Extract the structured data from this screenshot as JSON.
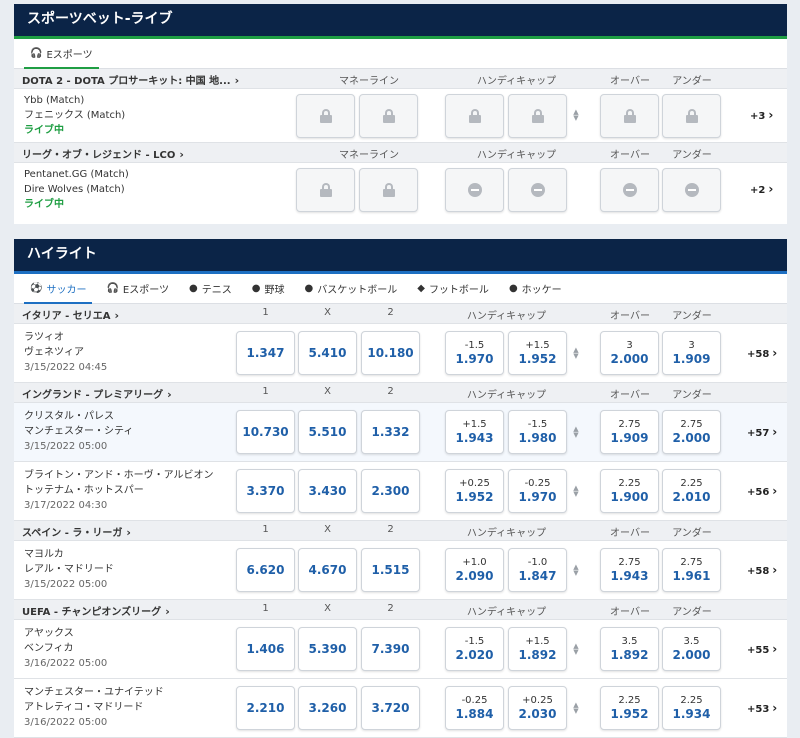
{
  "live": {
    "title": "スポーツベット-ライブ",
    "tab": "Eスポーツ",
    "columns": {
      "moneyline": "マネーライン",
      "handicap": "ハンディキャップ",
      "over": "オーバー",
      "under": "アンダー"
    },
    "leagues": [
      {
        "name": "DOTA 2 - DOTA プロサーキット: 中国 地...",
        "matches": [
          {
            "team1": "Ybb (Match)",
            "team2": "フェニックス (Match)",
            "status": "ライブ中",
            "more": "+3"
          }
        ]
      },
      {
        "name": "リーグ・オブ・レジェンド - LCO",
        "matches": [
          {
            "team1": "Pentanet.GG (Match)",
            "team2": "Dire Wolves (Match)",
            "status": "ライブ中",
            "more": "+2"
          }
        ]
      }
    ]
  },
  "highlights": {
    "title": "ハイライト",
    "tabs": [
      "サッカー",
      "Eスポーツ",
      "テニス",
      "野球",
      "バスケットボール",
      "フットボール",
      "ホッケー"
    ],
    "columns": {
      "one": "1",
      "x": "X",
      "two": "2",
      "handicap": "ハンディキャップ",
      "over": "オーバー",
      "under": "アンダー"
    },
    "leagues": [
      {
        "name": "イタリア - セリエA",
        "matches": [
          {
            "team1": "ラツィオ",
            "team2": "ヴェネツィア",
            "date": "3/15/2022 04:45",
            "o1": "1.347",
            "ox": "5.410",
            "o2": "10.180",
            "h1l": "-1.5",
            "h1": "1.970",
            "h2l": "+1.5",
            "h2": "1.952",
            "ovl": "3",
            "ov": "2.000",
            "unl": "3",
            "un": "1.909",
            "more": "+58"
          }
        ]
      },
      {
        "name": "イングランド - プレミアリーグ",
        "matches": [
          {
            "team1": "クリスタル・パレス",
            "team2": "マンチェスター・シティ",
            "date": "3/15/2022 05:00",
            "o1": "10.730",
            "ox": "5.510",
            "o2": "1.332",
            "h1l": "+1.5",
            "h1": "1.943",
            "h2l": "-1.5",
            "h2": "1.980",
            "ovl": "2.75",
            "ov": "1.909",
            "unl": "2.75",
            "un": "2.000",
            "more": "+57"
          },
          {
            "team1": "ブライトン・アンド・ホーヴ・アルビオン",
            "team2": "トッテナム・ホットスパー",
            "date": "3/17/2022 04:30",
            "o1": "3.370",
            "ox": "3.430",
            "o2": "2.300",
            "h1l": "+0.25",
            "h1": "1.952",
            "h2l": "-0.25",
            "h2": "1.970",
            "ovl": "2.25",
            "ov": "1.900",
            "unl": "2.25",
            "un": "2.010",
            "more": "+56"
          }
        ]
      },
      {
        "name": "スペイン - ラ・リーガ",
        "matches": [
          {
            "team1": "マヨルカ",
            "team2": "レアル・マドリード",
            "date": "3/15/2022 05:00",
            "o1": "6.620",
            "ox": "4.670",
            "o2": "1.515",
            "h1l": "+1.0",
            "h1": "2.090",
            "h2l": "-1.0",
            "h2": "1.847",
            "ovl": "2.75",
            "ov": "1.943",
            "unl": "2.75",
            "un": "1.961",
            "more": "+58"
          }
        ]
      },
      {
        "name": "UEFA - チャンピオンズリーグ",
        "matches": [
          {
            "team1": "アヤックス",
            "team2": "ベンフィカ",
            "date": "3/16/2022 05:00",
            "o1": "1.406",
            "ox": "5.390",
            "o2": "7.390",
            "h1l": "-1.5",
            "h1": "2.020",
            "h2l": "+1.5",
            "h2": "1.892",
            "ovl": "3.5",
            "ov": "1.892",
            "unl": "3.5",
            "un": "2.000",
            "more": "+55"
          },
          {
            "team1": "マンチェスター・ユナイテッド",
            "team2": "アトレティコ・マドリード",
            "date": "3/16/2022 05:00",
            "o1": "2.210",
            "ox": "3.260",
            "o2": "3.720",
            "h1l": "-0.25",
            "h1": "1.884",
            "h2l": "+0.25",
            "h2": "2.030",
            "ovl": "2.25",
            "ov": "1.952",
            "unl": "2.25",
            "un": "1.934",
            "more": "+53"
          }
        ]
      }
    ]
  }
}
